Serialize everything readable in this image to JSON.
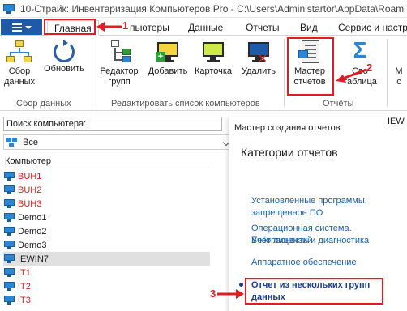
{
  "window": {
    "title": "10-Страйк: Инвентаризация Компьютеров Pro - C:\\Users\\Administartor\\AppData\\Roami"
  },
  "tabs": [
    {
      "label": "Главная"
    },
    {
      "label": "пьютеры"
    },
    {
      "label": "Данные"
    },
    {
      "label": "Отчеты"
    },
    {
      "label": "Вид"
    },
    {
      "label": "Сервис и настр"
    }
  ],
  "ribbon": {
    "groups": [
      {
        "label": "Сбор данных"
      },
      {
        "label": "Редактировать список компьютеров"
      },
      {
        "label": "Отчёты"
      }
    ],
    "buttons": [
      {
        "label": "Сбор\nданных",
        "icon": "network-collect-icon"
      },
      {
        "label": "Обновить",
        "icon": "refresh-icon"
      },
      {
        "label": "Редактор\nгрупп",
        "icon": "group-editor-icon"
      },
      {
        "label": "Добавить",
        "icon": "add-computer-icon"
      },
      {
        "label": "Карточка",
        "icon": "computer-card-icon"
      },
      {
        "label": "Удалить",
        "icon": "delete-computer-icon"
      },
      {
        "label": "Мастер\nотчетов",
        "icon": "report-wizard-icon"
      },
      {
        "label": "Сво\nтаблица",
        "icon": "sigma-icon"
      },
      {
        "label": "М\nс",
        "icon": ""
      }
    ]
  },
  "left_panel": {
    "search_label": "Поиск компьютера:",
    "group_combo_value": "Все",
    "column_header": "Компьютер",
    "computers": [
      {
        "name": "BUH1",
        "color": "#d42020"
      },
      {
        "name": "BUH2",
        "color": "#d42020"
      },
      {
        "name": "BUH3",
        "color": "#d42020"
      },
      {
        "name": "Demo1",
        "color": "#1a1a1a"
      },
      {
        "name": "Demo2",
        "color": "#1a1a1a"
      },
      {
        "name": "Demo3",
        "color": "#1a1a1a"
      },
      {
        "name": "IEWIN7",
        "color": "#1a1a1a",
        "selected": true
      },
      {
        "name": "IT1",
        "color": "#d42020"
      },
      {
        "name": "IT2",
        "color": "#d42020"
      },
      {
        "name": "IT3",
        "color": "#d42020"
      }
    ]
  },
  "popup": {
    "header": "Мастер создания отчетов",
    "category_title": "Категории отчетов",
    "items": [
      {
        "label": "Установленные программы, запрещенное ПО"
      },
      {
        "label": "Операционная система. Учёт лицензий"
      },
      {
        "label": "Безопасность и диагностика"
      },
      {
        "label": "Аппаратное обеспечение"
      },
      {
        "label": "Отчет из нескольких групп данных"
      }
    ]
  },
  "right_tail": "IEW",
  "annotations": [
    {
      "label": "1"
    },
    {
      "label": "2"
    },
    {
      "label": "3"
    }
  ],
  "colors": {
    "accent": "#1e5aa8",
    "highlight": "#e31b23",
    "offline": "#d42020",
    "link": "#1b5fa8"
  }
}
